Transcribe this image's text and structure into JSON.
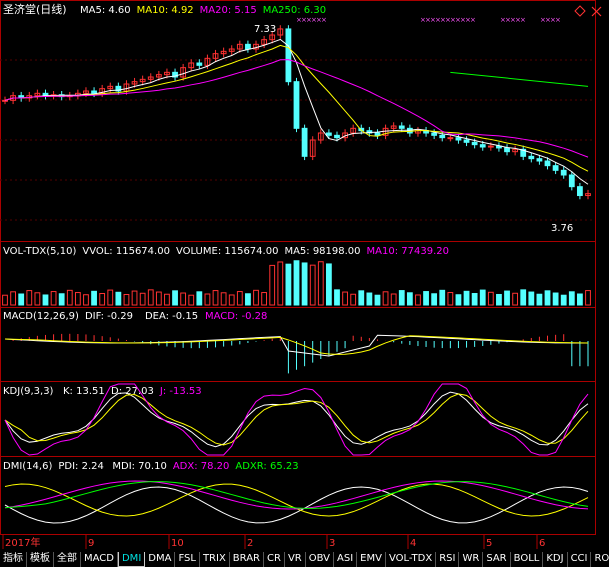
{
  "stock": {
    "name": "圣济堂(日线)"
  },
  "price_panel": {
    "indicators": [
      {
        "label": "MA5: 4.60",
        "color": "#ffffff"
      },
      {
        "label": "MA10: 4.92",
        "color": "#ffff00"
      },
      {
        "label": "MA20: 5.15",
        "color": "#ff00ff"
      },
      {
        "label": "MA250: 6.30",
        "color": "#00ff00"
      }
    ],
    "high_marker": "7.33",
    "low_marker": "3.76",
    "icons": [
      "diamond-icon",
      "close-icon"
    ]
  },
  "volume_panel": {
    "indicators": [
      {
        "label": "VOL-TDX(5,10)",
        "color": "#ffffff"
      },
      {
        "label": "VVOL: 115674.00",
        "color": "#ffffff"
      },
      {
        "label": "VOLUME: 115674.00",
        "color": "#ffffff"
      },
      {
        "label": "MA5: 98198.00",
        "color": "#ffffff"
      },
      {
        "label": "MA10: 77439.20",
        "color": "#ff00ff"
      }
    ]
  },
  "macd_panel": {
    "indicators": [
      {
        "label": "MACD(12,26,9)",
        "color": "#ffffff"
      },
      {
        "label": "DIF: -0.29",
        "color": "#ffffff"
      },
      {
        "label": "DEA: -0.15",
        "color": "#ffffff"
      },
      {
        "label": "MACD: -0.28",
        "color": "#ff00ff"
      }
    ]
  },
  "kdj_panel": {
    "indicators": [
      {
        "label": "KDJ(9,3,3)",
        "color": "#ffffff"
      },
      {
        "label": "K: 13.51",
        "color": "#ffffff"
      },
      {
        "label": "D: 27.03",
        "color": "#ffffff"
      },
      {
        "label": "J: -13.53",
        "color": "#ff00ff"
      }
    ]
  },
  "dmi_panel": {
    "indicators": [
      {
        "label": "DMI(14,6)",
        "color": "#ffffff"
      },
      {
        "label": "PDI: 2.24",
        "color": "#ffffff"
      },
      {
        "label": "MDI: 70.10",
        "color": "#ffffff"
      },
      {
        "label": "ADX: 78.20",
        "color": "#ff00ff"
      },
      {
        "label": "ADXR: 65.23",
        "color": "#00ff00"
      }
    ]
  },
  "time_axis": [
    "2017年",
    "9",
    "10",
    "2",
    "3",
    "4",
    "5",
    "6"
  ],
  "tabs": [
    "指标",
    "模板",
    "全部",
    "MACD",
    "DMI",
    "DMA",
    "FSL",
    "TRIX",
    "BRAR",
    "CR",
    "VR",
    "OBV",
    "ASI",
    "EMV",
    "VOL-TDX",
    "RSI",
    "WR",
    "SAR",
    "BOLL",
    "KDJ",
    "CCI",
    "ROC"
  ],
  "selected_tab": "DMI",
  "arrows": "◄►",
  "chart_data": {
    "type": "candlestick",
    "title": "圣济堂(日线)",
    "ma_values": {
      "MA5": 4.6,
      "MA10": 4.92,
      "MA20": 5.15,
      "MA250": 6.3
    },
    "price_ylim": [
      3.0,
      7.5
    ],
    "price_high": 7.33,
    "price_low": 3.76,
    "period_labels": [
      "2017年",
      "9",
      "10",
      "2",
      "3",
      "4",
      "5",
      "6"
    ],
    "close_series": [
      5.8,
      5.9,
      5.85,
      5.9,
      5.95,
      5.9,
      5.92,
      5.88,
      5.9,
      5.95,
      6.0,
      5.95,
      6.05,
      6.1,
      6.0,
      6.15,
      6.2,
      6.25,
      6.3,
      6.35,
      6.4,
      6.3,
      6.5,
      6.6,
      6.55,
      6.7,
      6.8,
      6.85,
      6.9,
      7.0,
      6.9,
      7.0,
      7.1,
      7.2,
      7.33,
      6.2,
      5.2,
      4.6,
      4.95,
      5.1,
      5.05,
      5.0,
      5.1,
      5.2,
      5.15,
      5.1,
      5.05,
      5.2,
      5.25,
      5.2,
      5.1,
      5.15,
      5.1,
      5.05,
      5.0,
      5.0,
      4.95,
      4.9,
      4.85,
      4.8,
      4.82,
      4.78,
      4.7,
      4.75,
      4.6,
      4.55,
      4.5,
      4.4,
      4.3,
      4.2,
      3.95,
      3.76,
      3.8
    ],
    "volume": {
      "VVOL": 115674.0,
      "VOLUME": 115674.0,
      "MA5": 98198.0,
      "MA10": 77439.2
    },
    "macd": {
      "DIF": -0.29,
      "DEA": -0.15,
      "MACD": -0.28
    },
    "kdj": {
      "K": 13.51,
      "D": 27.03,
      "J": -13.53
    },
    "dmi": {
      "PDI": 2.24,
      "MDI": 70.1,
      "ADX": 78.2,
      "ADXR": 65.23
    }
  }
}
